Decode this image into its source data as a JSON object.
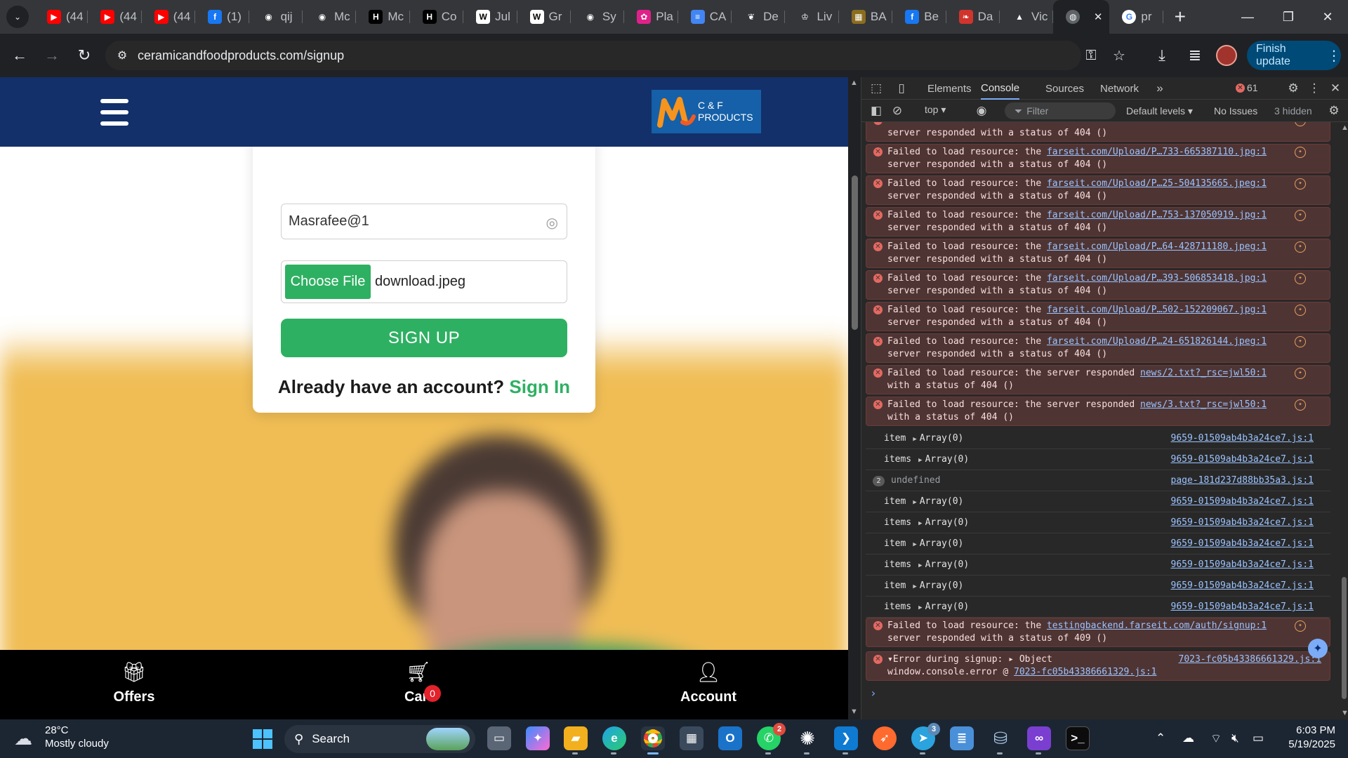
{
  "browser": {
    "tabs": [
      {
        "label": "(44",
        "icon": "youtube-icon",
        "color": "#ff0000",
        "glyph": "▶"
      },
      {
        "label": "(44",
        "icon": "youtube-icon",
        "color": "#ff0000",
        "glyph": "▶"
      },
      {
        "label": "(44",
        "icon": "youtube-icon",
        "color": "#ff0000",
        "glyph": "▶"
      },
      {
        "label": "(1)",
        "icon": "facebook-icon",
        "color": "#1877f2",
        "glyph": "f"
      },
      {
        "label": "qij",
        "icon": "github-icon",
        "color": "#35363a",
        "glyph": "◉"
      },
      {
        "label": "Mc",
        "icon": "github-icon",
        "color": "#35363a",
        "glyph": "◉"
      },
      {
        "label": "Mc",
        "icon": "hackerrank-icon",
        "color": "#000000",
        "glyph": "H"
      },
      {
        "label": "Co",
        "icon": "hackerrank-icon",
        "color": "#000000",
        "glyph": "H"
      },
      {
        "label": "Jul",
        "icon": "wikipedia-icon",
        "color": "#ffffff",
        "glyph": "W"
      },
      {
        "label": "Gr",
        "icon": "wikipedia-icon",
        "color": "#ffffff",
        "glyph": "W"
      },
      {
        "label": "Sy",
        "icon": "github-icon",
        "color": "#35363a",
        "glyph": "◉"
      },
      {
        "label": "Pla",
        "icon": "app-pink-icon",
        "color": "#e0218a",
        "glyph": "✿"
      },
      {
        "label": "CA",
        "icon": "google-docs-icon",
        "color": "#4285f4",
        "glyph": "≡"
      },
      {
        "label": "De",
        "icon": "leaf-icon",
        "color": "#35363a",
        "glyph": "❦"
      },
      {
        "label": "Liv",
        "icon": "crown-icon",
        "color": "#35363a",
        "glyph": "♔"
      },
      {
        "label": "BA",
        "icon": "game-icon",
        "color": "#8a6d1f",
        "glyph": "▦"
      },
      {
        "label": "Be",
        "icon": "facebook-icon",
        "color": "#1877f2",
        "glyph": "f"
      },
      {
        "label": "Da",
        "icon": "bird-icon",
        "color": "#d0342c",
        "glyph": "❧"
      },
      {
        "label": "Vic",
        "icon": "google-drive-icon",
        "color": "#35363a",
        "glyph": "▲"
      }
    ],
    "active_tab": {
      "icon": "globe-icon"
    },
    "last_tab": {
      "label": "pr",
      "icon": "google-icon"
    },
    "url": "ceramicandfoodproducts.com/signup",
    "finish_update_label": "Finish update"
  },
  "site": {
    "logo_line1": "C & F",
    "logo_line2": "PRODUCTS",
    "password_value": "Masrafee@1",
    "choose_file_label": "Choose File",
    "file_name": "download.jpeg",
    "signup_label": "SIGN UP",
    "signin_prompt": "Already have an account?",
    "signin_link": "Sign In",
    "nav": {
      "offers": "Offers",
      "cart": "Cart",
      "cart_count": "0",
      "account": "Account"
    }
  },
  "devtools": {
    "tabs": [
      "Elements",
      "Console",
      "Sources",
      "Network"
    ],
    "active_tab": "Console",
    "error_count": "61",
    "context": "top ▾",
    "filter_placeholder": "Filter",
    "levels": "Default levels ▾",
    "issues": "No Issues",
    "hidden": "3 hidden",
    "messages": [
      {
        "type": "err",
        "prefix": "",
        "link": "",
        "text2": "server responded with a status of 404 ()"
      },
      {
        "type": "err",
        "prefix": "Failed to load resource: the ",
        "link": "farseit.com/Upload/P…733-665387110.jpg:1",
        "text2": "server responded with a status of 404 ()"
      },
      {
        "type": "err",
        "prefix": "Failed to load resource: the ",
        "link": "farseit.com/Upload/P…25-504135665.jpeg:1",
        "text2": "server responded with a status of 404 ()"
      },
      {
        "type": "err",
        "prefix": "Failed to load resource: the ",
        "link": "farseit.com/Upload/P…753-137050919.jpg:1",
        "text2": "server responded with a status of 404 ()"
      },
      {
        "type": "err",
        "prefix": "Failed to load resource: the ",
        "link": "farseit.com/Upload/P…64-428711180.jpeg:1",
        "text2": "server responded with a status of 404 ()"
      },
      {
        "type": "err",
        "prefix": "Failed to load resource: the ",
        "link": "farseit.com/Upload/P…393-506853418.jpg:1",
        "text2": "server responded with a status of 404 ()"
      },
      {
        "type": "err",
        "prefix": "Failed to load resource: the ",
        "link": "farseit.com/Upload/P…502-152209067.jpg:1",
        "text2": "server responded with a status of 404 ()"
      },
      {
        "type": "err",
        "prefix": "Failed to load resource: the ",
        "link": "farseit.com/Upload/P…24-651826144.jpeg:1",
        "text2": "server responded with a status of 404 ()"
      },
      {
        "type": "err",
        "prefix": "Failed to load resource: the server responded ",
        "link": "news/2.txt?_rsc=jwl50:1",
        "text2": "with a status of 404 ()"
      },
      {
        "type": "err",
        "prefix": "Failed to load resource: the server responded ",
        "link": "news/3.txt?_rsc=jwl50:1",
        "text2": "with a status of 404 ()"
      },
      {
        "type": "log",
        "key": "item",
        "val": "Array(0)",
        "src": "9659-01509ab4b3a24ce7.js:1"
      },
      {
        "type": "log",
        "key": "items",
        "val": "Array(0)",
        "src": "9659-01509ab4b3a24ce7.js:1"
      },
      {
        "type": "undef",
        "count": "2",
        "key": "undefined",
        "src": "page-181d237d88bb35a3.js:1"
      },
      {
        "type": "log",
        "key": "item",
        "val": "Array(0)",
        "src": "9659-01509ab4b3a24ce7.js:1"
      },
      {
        "type": "log",
        "key": "items",
        "val": "Array(0)",
        "src": "9659-01509ab4b3a24ce7.js:1"
      },
      {
        "type": "log",
        "key": "item",
        "val": "Array(0)",
        "src": "9659-01509ab4b3a24ce7.js:1"
      },
      {
        "type": "log",
        "key": "items",
        "val": "Array(0)",
        "src": "9659-01509ab4b3a24ce7.js:1"
      },
      {
        "type": "log",
        "key": "item",
        "val": "Array(0)",
        "src": "9659-01509ab4b3a24ce7.js:1"
      },
      {
        "type": "log",
        "key": "items",
        "val": "Array(0)",
        "src": "9659-01509ab4b3a24ce7.js:1"
      },
      {
        "type": "err",
        "prefix": "Failed to load resource: the ",
        "link": "testingbackend.farseit.com/auth/signup:1",
        "text2": "server responded with a status of 409 ()"
      },
      {
        "type": "errx",
        "prefix": "▾Error during signup:  ▸ Object",
        "link": "7023-fc05b43386661329.js:1",
        "text2": "window.console.error @ ",
        "link2": "7023-fc05b43386661329.js:1"
      }
    ]
  },
  "taskbar": {
    "temperature": "28°C",
    "weather": "Mostly cloudy",
    "search_label": "Search",
    "time": "6:03 PM",
    "date": "5/19/2025",
    "whatsapp_badge": "2",
    "telegram_badge": "3"
  }
}
